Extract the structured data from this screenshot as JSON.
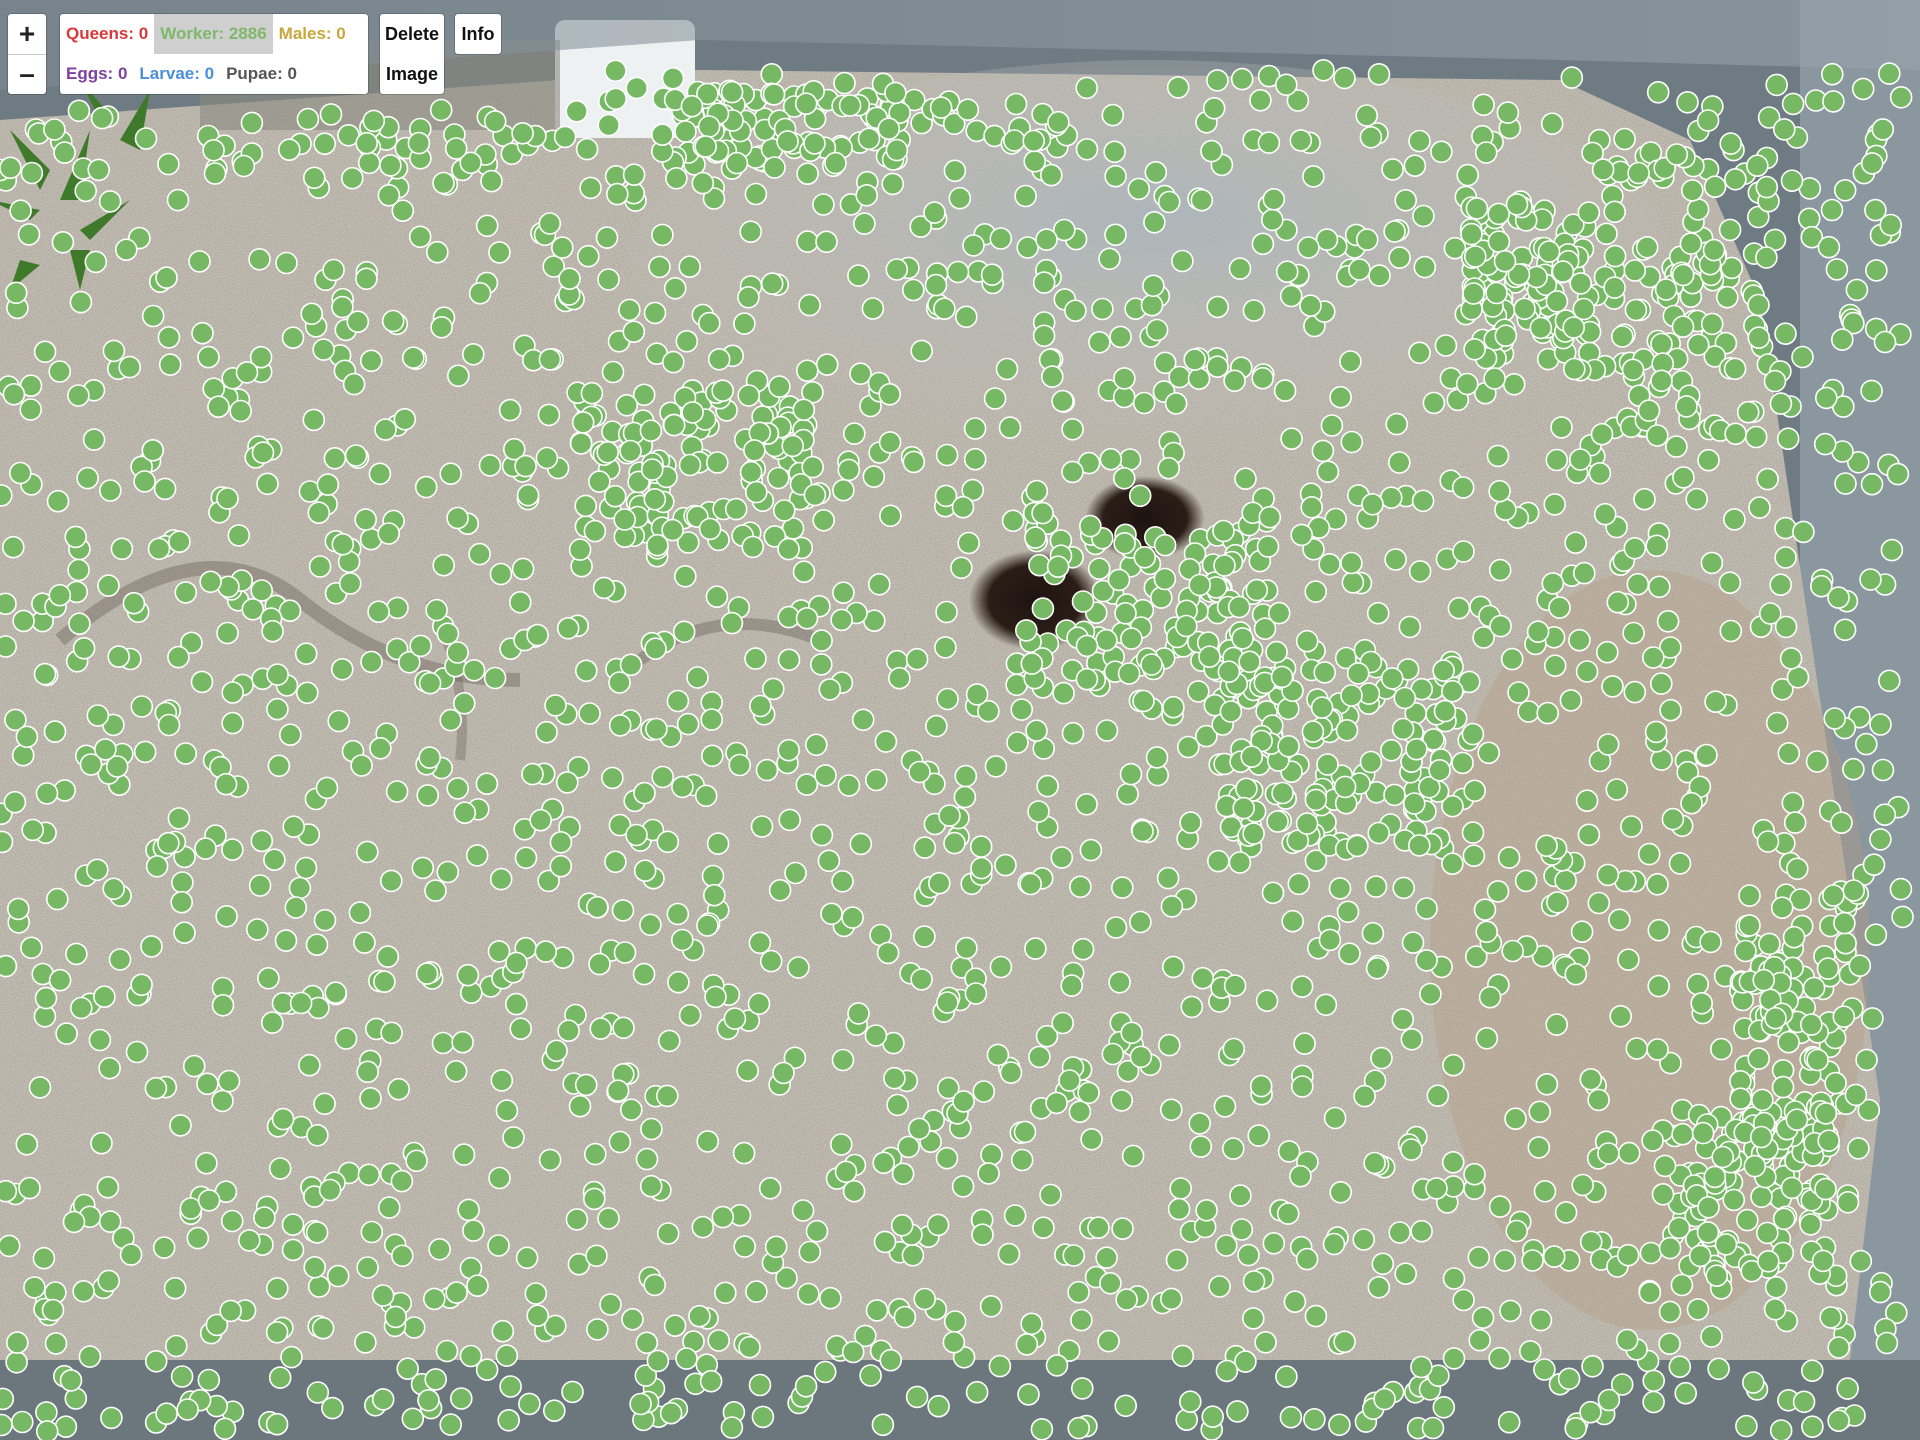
{
  "toolbar": {
    "zoom_in_label": "+",
    "zoom_out_label": "–",
    "delete_label": "Delete",
    "image_label": "Image",
    "info_label": "Info"
  },
  "counts": {
    "queens": "Queens: 0",
    "workers": "Worker: 2886",
    "males": "Males: 0",
    "eggs": "Eggs: 0",
    "larvae": "Larvae: 0",
    "pupae": "Pupae: 0"
  },
  "colors": {
    "queens": "#d93838",
    "workers": "#7fb86a",
    "males": "#c9a73c",
    "eggs": "#7d3fa0",
    "larvae": "#4a8fd8",
    "pupae": "#555555",
    "marker_fill": "#76b864",
    "marker_stroke": "#ffffff"
  },
  "annotation": {
    "class": "worker",
    "count": 2886
  }
}
